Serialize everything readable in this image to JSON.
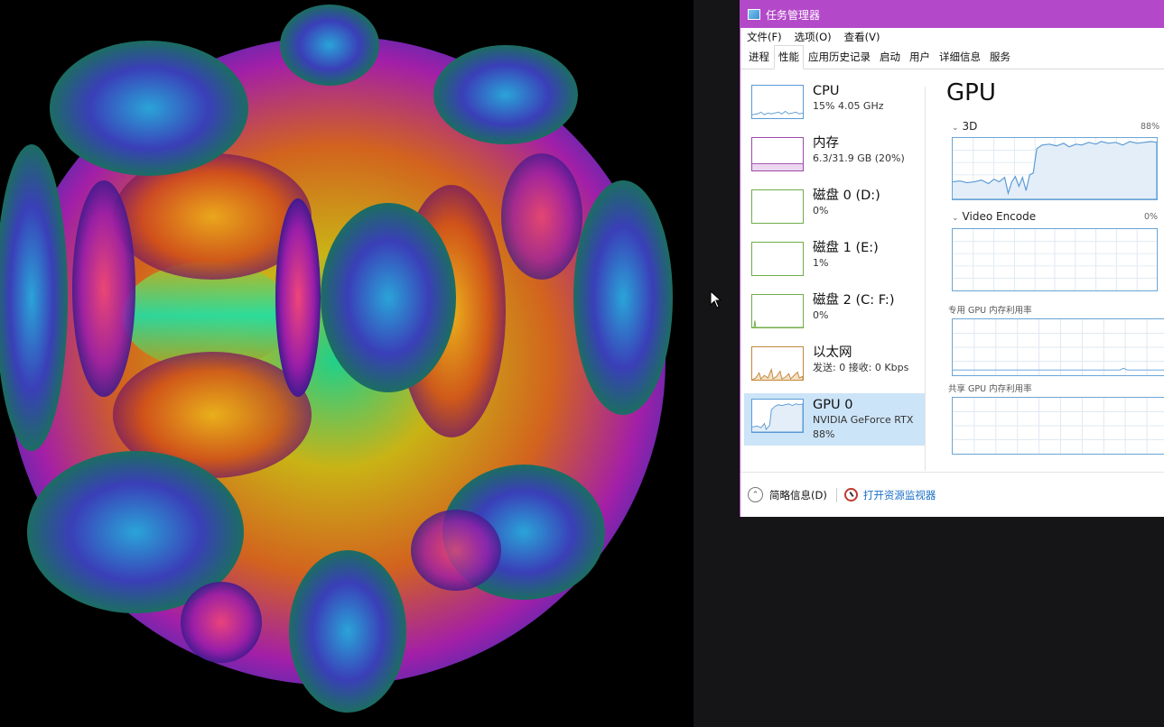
{
  "window": {
    "title": "任务管理器",
    "menu": [
      "文件(F)",
      "选项(O)",
      "查看(V)"
    ],
    "tabs": [
      "进程",
      "性能",
      "应用历史记录",
      "启动",
      "用户",
      "详细信息",
      "服务"
    ],
    "active_tab": "性能"
  },
  "resources": [
    {
      "name": "CPU",
      "sub": "15% 4.05 GHz",
      "color": "#5b9bd5",
      "selected": false
    },
    {
      "name": "内存",
      "sub": "6.3/31.9 GB (20%)",
      "color": "#9b4ba6",
      "selected": false
    },
    {
      "name": "磁盘 0 (D:)",
      "sub": "0%",
      "color": "#70ad47",
      "selected": false
    },
    {
      "name": "磁盘 1 (E:)",
      "sub": "1%",
      "color": "#70ad47",
      "selected": false
    },
    {
      "name": "磁盘 2 (C: F:)",
      "sub": "0%",
      "color": "#70ad47",
      "selected": false
    },
    {
      "name": "以太网",
      "sub": "发送: 0 接收: 0 Kbps",
      "color": "#c4873a",
      "selected": false
    },
    {
      "name": "GPU 0",
      "sub": "NVIDIA GeForce RTX",
      "sub2": "88%",
      "color": "#5b9bd5",
      "selected": true
    }
  ],
  "detail": {
    "title": "GPU",
    "graph_3d": {
      "label": "3D",
      "value_pct": "88%"
    },
    "graph_encode": {
      "label": "Video Encode",
      "value_pct": "0%"
    },
    "dedicated_label": "专用 GPU 内存利用率",
    "shared_label": "共享 GPU 内存利用率"
  },
  "footer": {
    "fewer_details": "简略信息(D)",
    "resource_monitor": "打开资源监视器"
  },
  "colors": {
    "titlebar": "#b349c9",
    "accent_blue": "#5b9bd5",
    "selection": "#cce4f7",
    "link": "#1a6fc7"
  }
}
